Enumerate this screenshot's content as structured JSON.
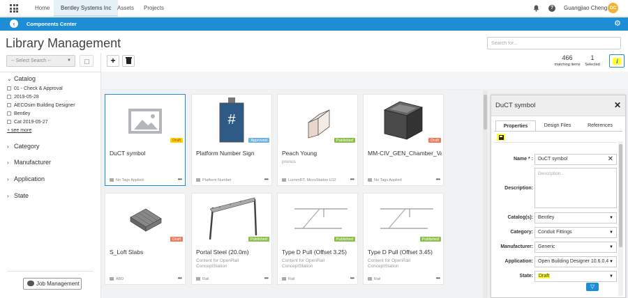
{
  "topnav": {
    "tabs": [
      "Home",
      "Bentley Systems Inc",
      "Assets",
      "Projects"
    ],
    "active_tab": "Bentley Systems Inc",
    "username": "Guangjiao Cheng",
    "avatar_initials": "GC"
  },
  "appbar": {
    "title": "Components Center"
  },
  "page": {
    "title": "Library Management",
    "search_placeholder": "Search for..."
  },
  "left": {
    "saved_search": "-- Select Search --",
    "catalog_title": "Catalog",
    "catalog_items": [
      "01 - Check & Approval",
      "2019-05-28",
      "AECOsim Building Designer",
      "Bentley",
      "Cat 2019-05-27"
    ],
    "see_more": "+ see more",
    "sections": [
      "Category",
      "Manufacturer",
      "Application",
      "State"
    ],
    "job_button": "Job Management"
  },
  "toolbar": {
    "add_label": "+",
    "matching_count": "466",
    "matching_label": "matching items",
    "selected_count": "1",
    "selected_label": "Selected",
    "info_label": "i"
  },
  "cards": [
    {
      "title": "DuCT symbol",
      "subtitle": "",
      "badge": "Draft",
      "tag": "No Tags Applied"
    },
    {
      "title": "Platform Number Sign",
      "subtitle": "",
      "badge": "Approved",
      "tag": "Platform Number"
    },
    {
      "title": "Peach Young",
      "subtitle": "prunus",
      "badge": "Published",
      "tag": "LumenRT, MicroStation U12"
    },
    {
      "title": "MM-CIV_GEN_Chamber_Va...",
      "subtitle": "",
      "badge": "Draft",
      "tag": "No Tags Applied"
    },
    {
      "title": "S_Loft Slabs",
      "subtitle": "",
      "badge": "Draft",
      "tag": "ABD"
    },
    {
      "title": "Portal Steel (20.0m)",
      "subtitle": "Content for OpenRail ConceptStation",
      "badge": "Published",
      "tag": "Rail"
    },
    {
      "title": "Type D Pull (Offset 3.25)",
      "subtitle": "Content for OpenRail ConceptStation",
      "badge": "Published",
      "tag": "Rail"
    },
    {
      "title": "Type D Pull (Offset 3.45)",
      "subtitle": "Content for OpenRail ConceptStation",
      "badge": "Published",
      "tag": "Rail"
    }
  ],
  "detail": {
    "title": "DuCT symbol",
    "tabs": [
      "Properties",
      "Design Files",
      "References"
    ],
    "labels": {
      "name": "Name * :",
      "description": "Description:",
      "catalogs": "Catalog(s):",
      "category": "Category:",
      "manufacturer": "Manufacturer:",
      "application": "Application:",
      "state": "State:"
    },
    "values": {
      "name": "DuCT symbol",
      "description_placeholder": "Description...",
      "catalogs": "Bentley",
      "category": "Conduit Fittings",
      "manufacturer": "Generic",
      "application": "Open Building Designer 10.6.0.4",
      "state": "Draft"
    }
  },
  "colors": {
    "accent": "#1d8ed6",
    "highlight": "#ffff3a",
    "draft": "#f07a5a",
    "published": "#8cc04b",
    "approved": "#6fb3e0"
  }
}
